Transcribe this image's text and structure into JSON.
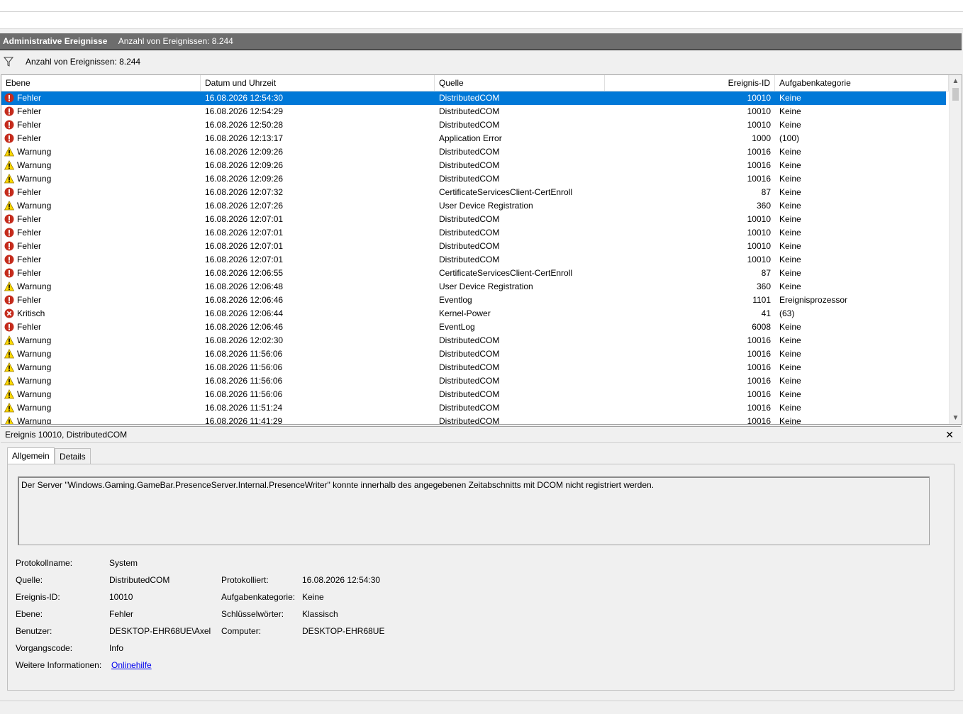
{
  "header": {
    "title": "Administrative Ereignisse",
    "count": "Anzahl von Ereignissen: 8.244"
  },
  "filter": {
    "text": "Anzahl von Ereignissen: 8.244"
  },
  "columns": {
    "level": "Ebene",
    "date": "Datum und Uhrzeit",
    "source": "Quelle",
    "id": "Ereignis-ID",
    "category": "Aufgabenkategorie"
  },
  "events": [
    {
      "level": "Fehler",
      "date": "16.08.2026 12:54:30",
      "source": "DistributedCOM",
      "id": "10010",
      "category": "Keine",
      "icon": "error-icon",
      "selected": true
    },
    {
      "level": "Fehler",
      "date": "16.08.2026 12:54:29",
      "source": "DistributedCOM",
      "id": "10010",
      "category": "Keine",
      "icon": "error-icon"
    },
    {
      "level": "Fehler",
      "date": "16.08.2026 12:50:28",
      "source": "DistributedCOM",
      "id": "10010",
      "category": "Keine",
      "icon": "error-icon"
    },
    {
      "level": "Fehler",
      "date": "16.08.2026 12:13:17",
      "source": "Application Error",
      "id": "1000",
      "category": "(100)",
      "icon": "error-icon"
    },
    {
      "level": "Warnung",
      "date": "16.08.2026 12:09:26",
      "source": "DistributedCOM",
      "id": "10016",
      "category": "Keine",
      "icon": "warning-icon"
    },
    {
      "level": "Warnung",
      "date": "16.08.2026 12:09:26",
      "source": "DistributedCOM",
      "id": "10016",
      "category": "Keine",
      "icon": "warning-icon"
    },
    {
      "level": "Warnung",
      "date": "16.08.2026 12:09:26",
      "source": "DistributedCOM",
      "id": "10016",
      "category": "Keine",
      "icon": "warning-icon"
    },
    {
      "level": "Fehler",
      "date": "16.08.2026 12:07:32",
      "source": "CertificateServicesClient-CertEnroll",
      "id": "87",
      "category": "Keine",
      "icon": "error-icon"
    },
    {
      "level": "Warnung",
      "date": "16.08.2026 12:07:26",
      "source": "User Device Registration",
      "id": "360",
      "category": "Keine",
      "icon": "warning-icon"
    },
    {
      "level": "Fehler",
      "date": "16.08.2026 12:07:01",
      "source": "DistributedCOM",
      "id": "10010",
      "category": "Keine",
      "icon": "error-icon"
    },
    {
      "level": "Fehler",
      "date": "16.08.2026 12:07:01",
      "source": "DistributedCOM",
      "id": "10010",
      "category": "Keine",
      "icon": "error-icon"
    },
    {
      "level": "Fehler",
      "date": "16.08.2026 12:07:01",
      "source": "DistributedCOM",
      "id": "10010",
      "category": "Keine",
      "icon": "error-icon"
    },
    {
      "level": "Fehler",
      "date": "16.08.2026 12:07:01",
      "source": "DistributedCOM",
      "id": "10010",
      "category": "Keine",
      "icon": "error-icon"
    },
    {
      "level": "Fehler",
      "date": "16.08.2026 12:06:55",
      "source": "CertificateServicesClient-CertEnroll",
      "id": "87",
      "category": "Keine",
      "icon": "error-icon"
    },
    {
      "level": "Warnung",
      "date": "16.08.2026 12:06:48",
      "source": "User Device Registration",
      "id": "360",
      "category": "Keine",
      "icon": "warning-icon"
    },
    {
      "level": "Fehler",
      "date": "16.08.2026 12:06:46",
      "source": "Eventlog",
      "id": "1101",
      "category": "Ereignisprozessor",
      "icon": "error-icon"
    },
    {
      "level": "Kritisch",
      "date": "16.08.2026 12:06:44",
      "source": "Kernel-Power",
      "id": "41",
      "category": "(63)",
      "icon": "critical-icon"
    },
    {
      "level": "Fehler",
      "date": "16.08.2026 12:06:46",
      "source": "EventLog",
      "id": "6008",
      "category": "Keine",
      "icon": "error-icon"
    },
    {
      "level": "Warnung",
      "date": "16.08.2026 12:02:30",
      "source": "DistributedCOM",
      "id": "10016",
      "category": "Keine",
      "icon": "warning-icon"
    },
    {
      "level": "Warnung",
      "date": "16.08.2026 11:56:06",
      "source": "DistributedCOM",
      "id": "10016",
      "category": "Keine",
      "icon": "warning-icon"
    },
    {
      "level": "Warnung",
      "date": "16.08.2026 11:56:06",
      "source": "DistributedCOM",
      "id": "10016",
      "category": "Keine",
      "icon": "warning-icon"
    },
    {
      "level": "Warnung",
      "date": "16.08.2026 11:56:06",
      "source": "DistributedCOM",
      "id": "10016",
      "category": "Keine",
      "icon": "warning-icon"
    },
    {
      "level": "Warnung",
      "date": "16.08.2026 11:56:06",
      "source": "DistributedCOM",
      "id": "10016",
      "category": "Keine",
      "icon": "warning-icon"
    },
    {
      "level": "Warnung",
      "date": "16.08.2026 11:51:24",
      "source": "DistributedCOM",
      "id": "10016",
      "category": "Keine",
      "icon": "warning-icon"
    },
    {
      "level": "Warnung",
      "date": "16.08.2026 11:41:29",
      "source": "DistributedCOM",
      "id": "10016",
      "category": "Keine",
      "icon": "warning-icon"
    }
  ],
  "detail": {
    "title": "Ereignis 10010, DistributedCOM",
    "close_glyph": "✕",
    "tabs": [
      "Allgemein",
      "Details"
    ],
    "message": "Der Server \"Windows.Gaming.GameBar.PresenceServer.Internal.PresenceWriter\" konnte innerhalb des angegebenen Zeitabschnitts mit DCOM nicht registriert werden.",
    "labels": {
      "log": "Protokollname:",
      "source": "Quelle:",
      "event_id": "Ereignis-ID:",
      "level": "Ebene:",
      "user": "Benutzer:",
      "opcode": "Vorgangscode:",
      "more_info": "Weitere Informationen:",
      "logged": "Protokolliert:",
      "category": "Aufgabenkategorie:",
      "keywords": "Schlüsselwörter:",
      "computer": "Computer:"
    },
    "values": {
      "log": "System",
      "source": "DistributedCOM",
      "event_id": "10010",
      "level": "Fehler",
      "user": "DESKTOP-EHR68UE\\Axel",
      "opcode": "Info",
      "more_info": "Onlinehilfe",
      "logged": "16.08.2026 12:54:30",
      "category": "Keine",
      "keywords": "Klassisch",
      "computer": "DESKTOP-EHR68UE"
    }
  },
  "colors": {
    "selection": "#0078d7",
    "error": "#c42b1c",
    "warning": "#ffd800",
    "critical": "#c42b1c",
    "titlebar": "#6d6d6d"
  }
}
